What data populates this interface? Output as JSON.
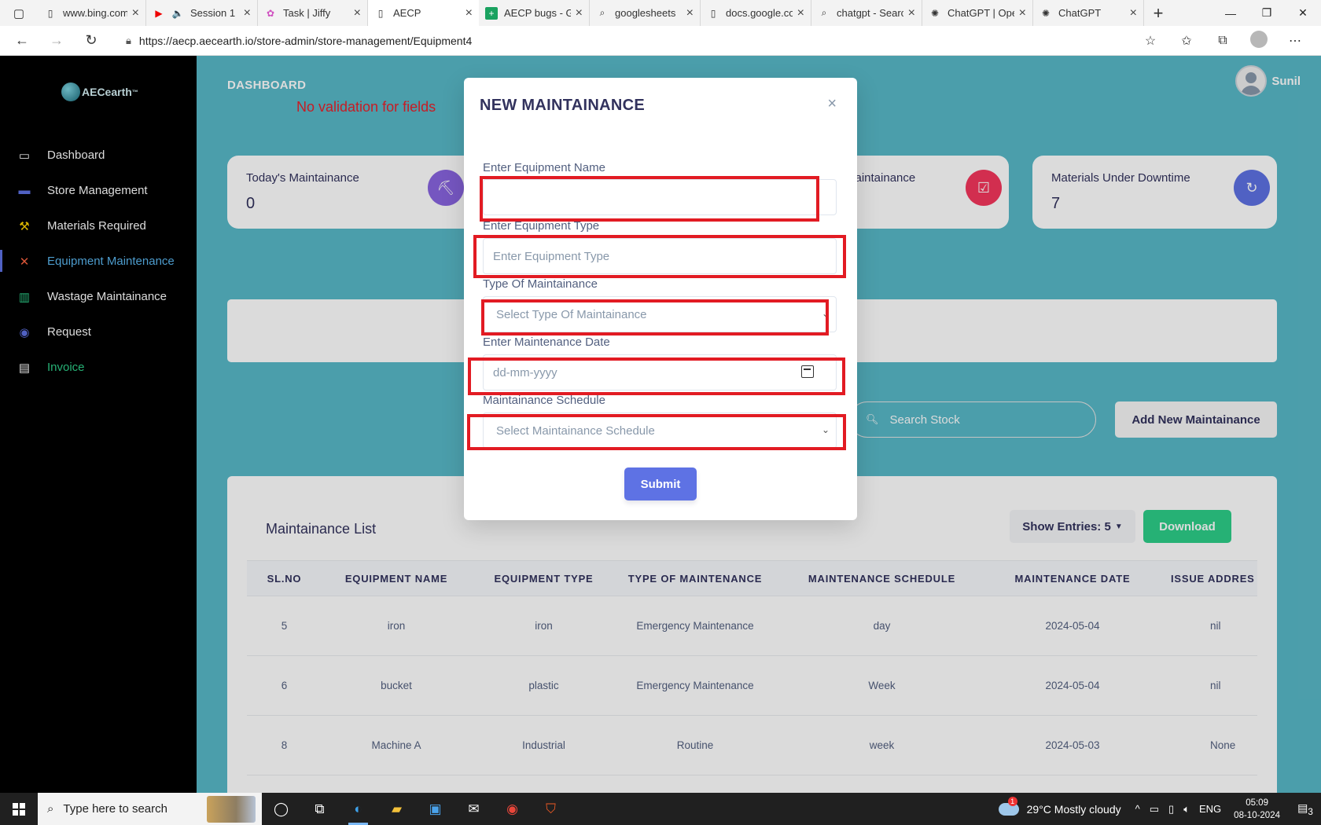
{
  "browser": {
    "tabs": [
      {
        "title": "www.bing.com",
        "icon": "page-icon"
      },
      {
        "title": "Session 1",
        "icon": "youtube-icon"
      },
      {
        "title": "Task | Jiffy",
        "icon": "jiffy-icon"
      },
      {
        "title": "AECP",
        "icon": "page-icon",
        "active": true
      },
      {
        "title": "AECP bugs - Google Sheets",
        "icon": "sheets-icon"
      },
      {
        "title": "googlesheets",
        "icon": "search-icon"
      },
      {
        "title": "docs.google.com",
        "icon": "page-icon"
      },
      {
        "title": "chatgpt - Search",
        "icon": "search-icon"
      },
      {
        "title": "ChatGPT | OpenAI",
        "icon": "openai-icon"
      },
      {
        "title": "ChatGPT",
        "icon": "openai-icon"
      }
    ],
    "url": "https://aecp.aecearth.io/store-admin/store-management/Equipment4"
  },
  "app": {
    "logo_text": "AECearth",
    "logo_tm": "™",
    "dashboard_title": "DASHBOARD",
    "annotation": "No validation for fields",
    "user_name": "Sunil",
    "nav": [
      {
        "label": "Dashboard",
        "icon": "monitor-icon"
      },
      {
        "label": "Store Management",
        "icon": "store-icon"
      },
      {
        "label": "Materials Required",
        "icon": "hammer-icon"
      },
      {
        "label": "Equipment Maintenance",
        "icon": "tools-icon",
        "active": true
      },
      {
        "label": "Wastage Maintainance",
        "icon": "trash-icon"
      },
      {
        "label": "Request",
        "icon": "request-icon"
      },
      {
        "label": "Invoice",
        "icon": "invoice-icon"
      }
    ],
    "stats": [
      {
        "title": "Today's Maintainance",
        "value": "0",
        "color": "#8965e0"
      },
      {
        "title": "Maintainance",
        "value": "",
        "color": "#f5365c"
      },
      {
        "title": "Materials Under Downtime",
        "value": "7",
        "color": "#5e72e4"
      }
    ],
    "search_placeholder": "Search Stock",
    "add_new_label": "Add New Maintainance",
    "list": {
      "title": "Maintainance List",
      "show_entries_label": "Show Entries: 5",
      "download_label": "Download",
      "columns": [
        "SL.NO",
        "EQUIPMENT NAME",
        "EQUIPMENT TYPE",
        "TYPE OF MAINTENANCE",
        "MAINTENANCE SCHEDULE",
        "MAINTENANCE DATE",
        "ISSUE ADDRES"
      ],
      "rows": [
        [
          "5",
          "iron",
          "iron",
          "Emergency Maintenance",
          "day",
          "2024-05-04",
          "nil"
        ],
        [
          "6",
          "bucket",
          "plastic",
          "Emergency Maintenance",
          "Week",
          "2024-05-04",
          "nil"
        ],
        [
          "8",
          "Machine A",
          "Industrial",
          "Routine",
          "week",
          "2024-05-03",
          "None"
        ]
      ]
    }
  },
  "modal": {
    "title": "NEW MAINTAINANCE",
    "close": "×",
    "fields": {
      "name_label": "Enter Equipment Name",
      "name_value": "",
      "type_label": "Enter Equipment Type",
      "type_placeholder": "Enter Equipment Type",
      "maint_type_label": "Type Of Maintainance",
      "maint_type_value": "Select Type Of Maintainance",
      "date_label": "Enter Maintenance Date",
      "date_placeholder": "dd-mm-yyyy",
      "schedule_label": "Maintainance Schedule",
      "schedule_value": "Select Maintainance Schedule"
    },
    "submit_label": "Submit",
    "highlight_color": "#e21b23"
  },
  "taskbar": {
    "search_placeholder": "Type here to search",
    "weather_badge": "1",
    "weather": "29°C  Mostly cloudy",
    "lang": "ENG",
    "time": "05:09",
    "date": "08-10-2024",
    "notif_count": "3"
  }
}
